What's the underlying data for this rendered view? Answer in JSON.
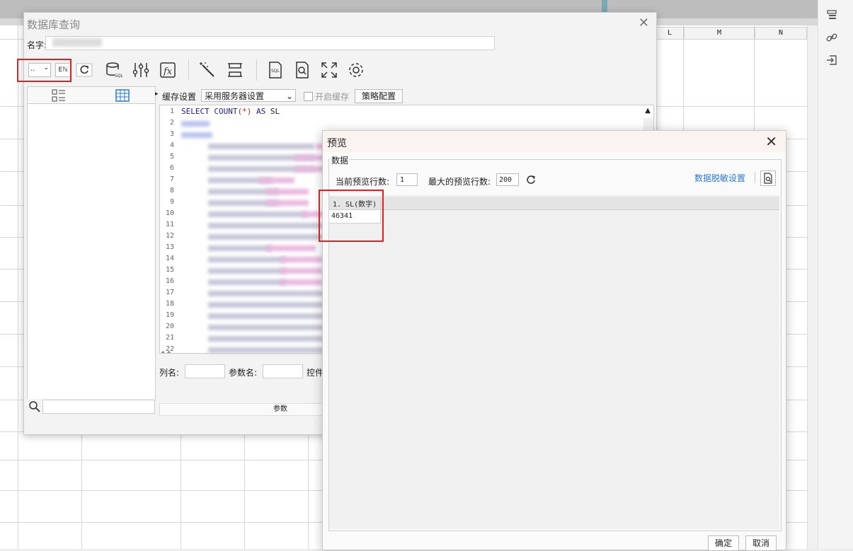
{
  "spreadsheet": {
    "columns": [
      "L",
      "M",
      "N"
    ]
  },
  "db_query_dialog": {
    "title": "数据库查询",
    "name_label": "名字:",
    "datasource_select_value": "..",
    "cache_label": "缓存设置",
    "cache_select_value": "采用服务器设置",
    "enable_cache_label": "开启缓存",
    "strategy_button": "策略配置",
    "sql_first_line": [
      "SELECT",
      "COUNT",
      "(*)",
      "AS",
      "SL"
    ],
    "line_numbers": [
      "1",
      "2",
      "3",
      "4",
      "5",
      "6",
      "7",
      "8",
      "9",
      "10",
      "11",
      "12",
      "13",
      "14",
      "15",
      "16",
      "17",
      "18",
      "19",
      "20",
      "21",
      "22"
    ],
    "column_name_label": "列名:",
    "param_name_label": "参数名:",
    "control_label": "控件",
    "params_tab": "参数"
  },
  "preview_dialog": {
    "title": "预览",
    "group_label": "数据",
    "current_rows_label": "当前预览行数:",
    "current_rows_value": "1",
    "max_rows_label": "最大的预览行数:",
    "max_rows_value": "200",
    "mask_settings_link": "数据脱敏设置",
    "table_header": "1. SL(数字)",
    "table_value": "46341",
    "ok_button": "确定",
    "cancel_button": "取消"
  },
  "colors": {
    "highlight_red": "#e02020",
    "link_blue": "#2b7bd6",
    "sql_keyword": "#1a1aa6",
    "sql_paren": "#d02020"
  }
}
